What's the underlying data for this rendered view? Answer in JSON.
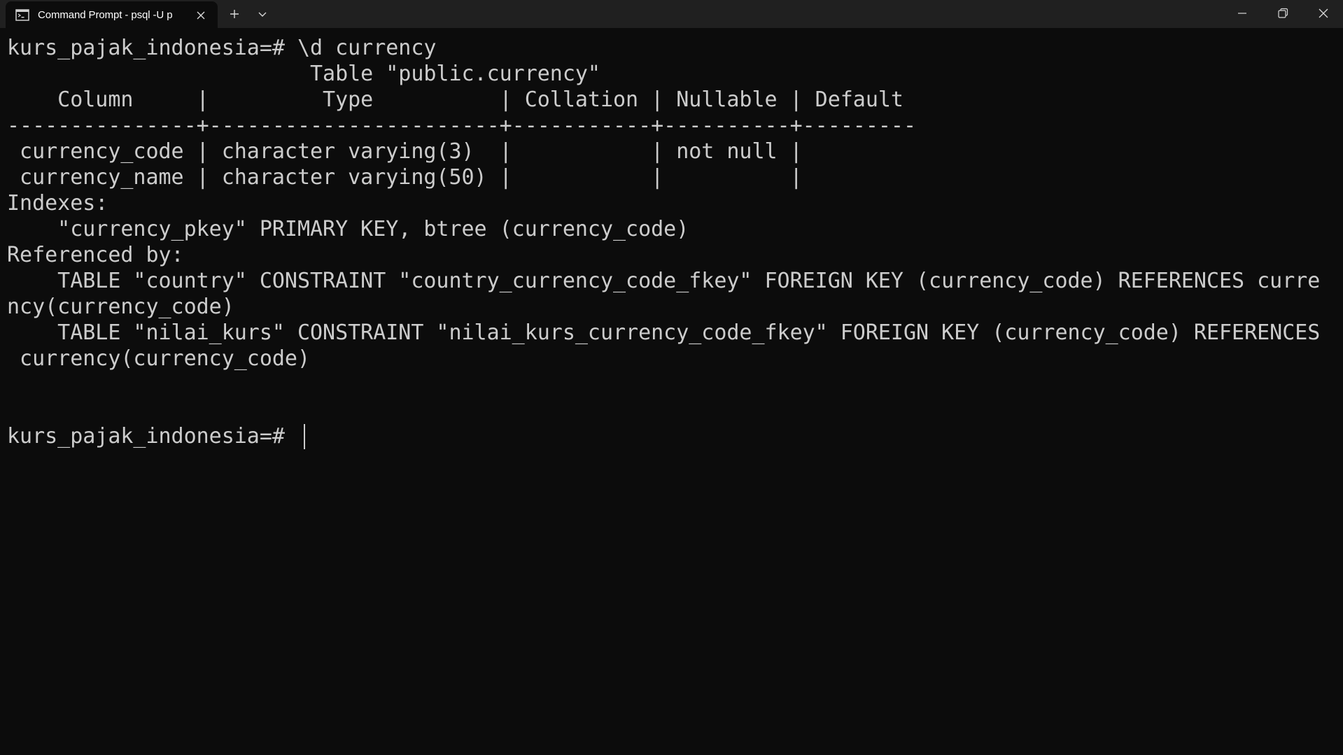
{
  "window": {
    "tab_title": "Command Prompt - psql  -U p",
    "icons": {
      "tab_icon": "terminal-icon",
      "close": "close-icon",
      "new_tab": "plus-icon",
      "dropdown": "chevron-down-icon",
      "minimize": "minimize-icon",
      "restore": "restore-icon",
      "window_close": "close-icon"
    }
  },
  "colors": {
    "background": "#0c0c0c",
    "titlebar": "#202020",
    "text": "#cccccc"
  },
  "terminal": {
    "lines": [
      "kurs_pajak_indonesia=# \\d currency",
      "                        Table \"public.currency\"",
      "    Column     |         Type          | Collation | Nullable | Default",
      "---------------+-----------------------+-----------+----------+---------",
      " currency_code | character varying(3)  |           | not null |",
      " currency_name | character varying(50) |           |          |",
      "Indexes:",
      "    \"currency_pkey\" PRIMARY KEY, btree (currency_code)",
      "Referenced by:",
      "    TABLE \"country\" CONSTRAINT \"country_currency_code_fkey\" FOREIGN KEY (currency_code) REFERENCES curre",
      "ncy(currency_code)",
      "    TABLE \"nilai_kurs\" CONSTRAINT \"nilai_kurs_currency_code_fkey\" FOREIGN KEY (currency_code) REFERENCES",
      " currency(currency_code)",
      "",
      "",
      "kurs_pajak_indonesia=# "
    ]
  }
}
